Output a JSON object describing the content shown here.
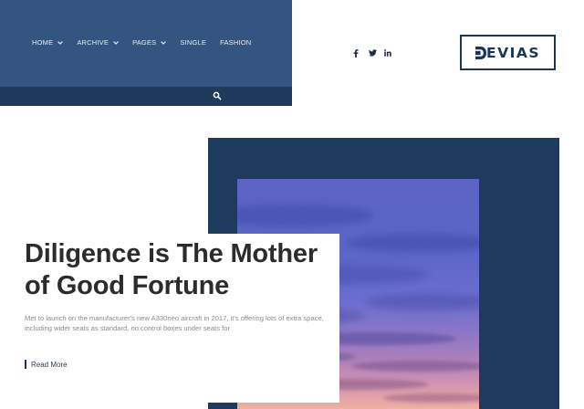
{
  "nav": {
    "items": [
      {
        "label": "HOME",
        "has_dropdown": true
      },
      {
        "label": "ARCHIVE",
        "has_dropdown": true
      },
      {
        "label": "PAGES",
        "has_dropdown": true
      },
      {
        "label": "SINGLE",
        "has_dropdown": false
      },
      {
        "label": "FASHION",
        "has_dropdown": false
      }
    ]
  },
  "search": {
    "icon": "search-icon"
  },
  "social": [
    {
      "name": "facebook",
      "icon": "facebook-icon"
    },
    {
      "name": "twitter",
      "icon": "twitter-icon"
    },
    {
      "name": "linkedin",
      "icon": "linkedin-icon"
    }
  ],
  "logo": {
    "text": "EVIAS",
    "mark": "D"
  },
  "hero": {
    "title": "Diligence is The Mother of Good Fortune",
    "excerpt": "Met to launch on the manufacturer's new A330neo aircraft in 2017, it's offering lots of extra space, including wider seats as standard, no control boxes under seats for",
    "read_more": "Read More"
  },
  "colors": {
    "nav_bg": "#335580",
    "search_bar_bg": "#1d3a5c",
    "hero_bg": "#1e3a5c",
    "brand": "#1e3655"
  }
}
